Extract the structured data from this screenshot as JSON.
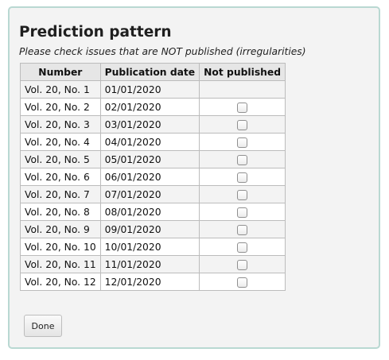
{
  "form": {
    "title": "Prediction pattern",
    "subtitle": "Please check issues that are NOT published (irregularities)",
    "done_label": "Done"
  },
  "table": {
    "headers": [
      "Number",
      "Publication date",
      "Not published"
    ],
    "rows": [
      {
        "number": "Vol. 20, No. 1",
        "date": "01/01/2020",
        "has_checkbox": false,
        "checked": false
      },
      {
        "number": "Vol. 20, No. 2",
        "date": "02/01/2020",
        "has_checkbox": true,
        "checked": false
      },
      {
        "number": "Vol. 20, No. 3",
        "date": "03/01/2020",
        "has_checkbox": true,
        "checked": false
      },
      {
        "number": "Vol. 20, No. 4",
        "date": "04/01/2020",
        "has_checkbox": true,
        "checked": false
      },
      {
        "number": "Vol. 20, No. 5",
        "date": "05/01/2020",
        "has_checkbox": true,
        "checked": false
      },
      {
        "number": "Vol. 20, No. 6",
        "date": "06/01/2020",
        "has_checkbox": true,
        "checked": false
      },
      {
        "number": "Vol. 20, No. 7",
        "date": "07/01/2020",
        "has_checkbox": true,
        "checked": false
      },
      {
        "number": "Vol. 20, No. 8",
        "date": "08/01/2020",
        "has_checkbox": true,
        "checked": false
      },
      {
        "number": "Vol. 20, No. 9",
        "date": "09/01/2020",
        "has_checkbox": true,
        "checked": false
      },
      {
        "number": "Vol. 20, No. 10",
        "date": "10/01/2020",
        "has_checkbox": true,
        "checked": false
      },
      {
        "number": "Vol. 20, No. 11",
        "date": "11/01/2020",
        "has_checkbox": true,
        "checked": false
      },
      {
        "number": "Vol. 20, No. 12",
        "date": "12/01/2020",
        "has_checkbox": true,
        "checked": false
      }
    ]
  },
  "colors": {
    "panel_border": "#b9d8d2",
    "panel_background": "#f3f3f3",
    "header_background": "#e6e6e6"
  }
}
